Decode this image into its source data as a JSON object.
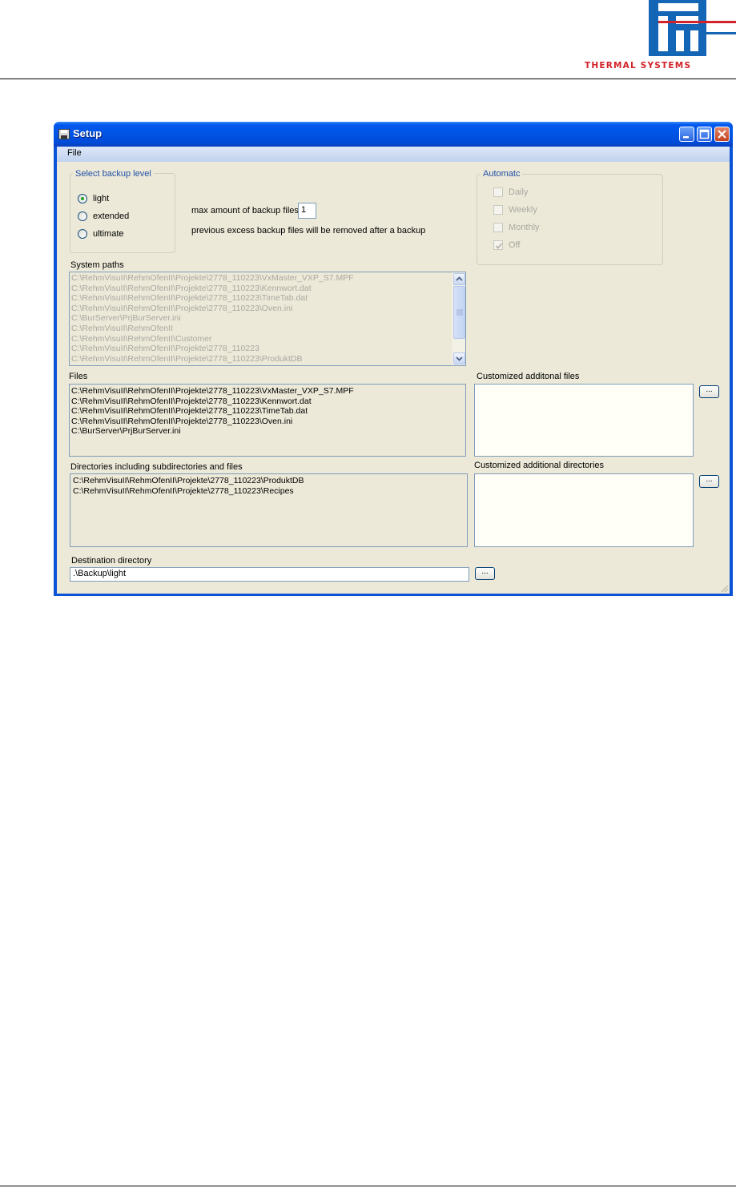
{
  "logo": {
    "text": "THERMAL SYSTEMS",
    "brand": "remm",
    "colors": [
      "#1565b6",
      "#d2232a"
    ]
  },
  "window": {
    "title": "Setup"
  },
  "menu": {
    "file": "File"
  },
  "backup_level": {
    "title": "Select backup level",
    "options": [
      "light",
      "extended",
      "ultimate"
    ],
    "selected": "light"
  },
  "max_backup": {
    "label": "max amount of backup files",
    "value": "1",
    "note": "previous excess backup files will be removed after a  backup"
  },
  "automatic": {
    "title": "Automatc",
    "options": [
      {
        "label": "Daily",
        "checked": false
      },
      {
        "label": "Weekly",
        "checked": false
      },
      {
        "label": "Monthly",
        "checked": false
      },
      {
        "label": "Off",
        "checked": true
      }
    ]
  },
  "system_paths": {
    "label": "System paths",
    "items": [
      "C:\\RehmVisuII\\RehmOfenII\\Projekte\\2778_110223\\VxMaster_VXP_S7.MPF",
      "C:\\RehmVisuII\\RehmOfenII\\Projekte\\2778_110223\\Kennwort.dat",
      "C:\\RehmVisuII\\RehmOfenII\\Projekte\\2778_110223\\TimeTab.dat",
      "C:\\RehmVisuII\\RehmOfenII\\Projekte\\2778_110223\\Oven.ini",
      "C:\\BurServer\\PrjBurServer.ini",
      "C:\\RehmVisuII\\RehmOfenII",
      "C:\\RehmVisuII\\RehmOfenII\\Customer",
      "C:\\RehmVisuII\\RehmOfenII\\Projekte\\2778_110223",
      "C:\\RehmVisuII\\RehmOfenII\\Projekte\\2778_110223\\ProduktDB"
    ]
  },
  "files": {
    "label": "Files",
    "items": [
      "C:\\RehmVisuII\\RehmOfenII\\Projekte\\2778_110223\\VxMaster_VXP_S7.MPF",
      "C:\\RehmVisuII\\RehmOfenII\\Projekte\\2778_110223\\Kennwort.dat",
      "C:\\RehmVisuII\\RehmOfenII\\Projekte\\2778_110223\\TimeTab.dat",
      "C:\\RehmVisuII\\RehmOfenII\\Projekte\\2778_110223\\Oven.ini",
      "C:\\BurServer\\PrjBurServer.ini"
    ]
  },
  "custom_files": {
    "label": "Customized additonal files",
    "button": "..."
  },
  "directories": {
    "label": "Directories including subdirectories and files",
    "items": [
      "C:\\RehmVisuII\\RehmOfenII\\Projekte\\2778_110223\\ProduktDB",
      "C:\\RehmVisuII\\RehmOfenII\\Projekte\\2778_110223\\Recipes"
    ]
  },
  "custom_dirs": {
    "label": "Customized additional directories",
    "button": "..."
  },
  "destination": {
    "label": "Destination directory",
    "value": ".\\Backup\\light",
    "button": "..."
  }
}
